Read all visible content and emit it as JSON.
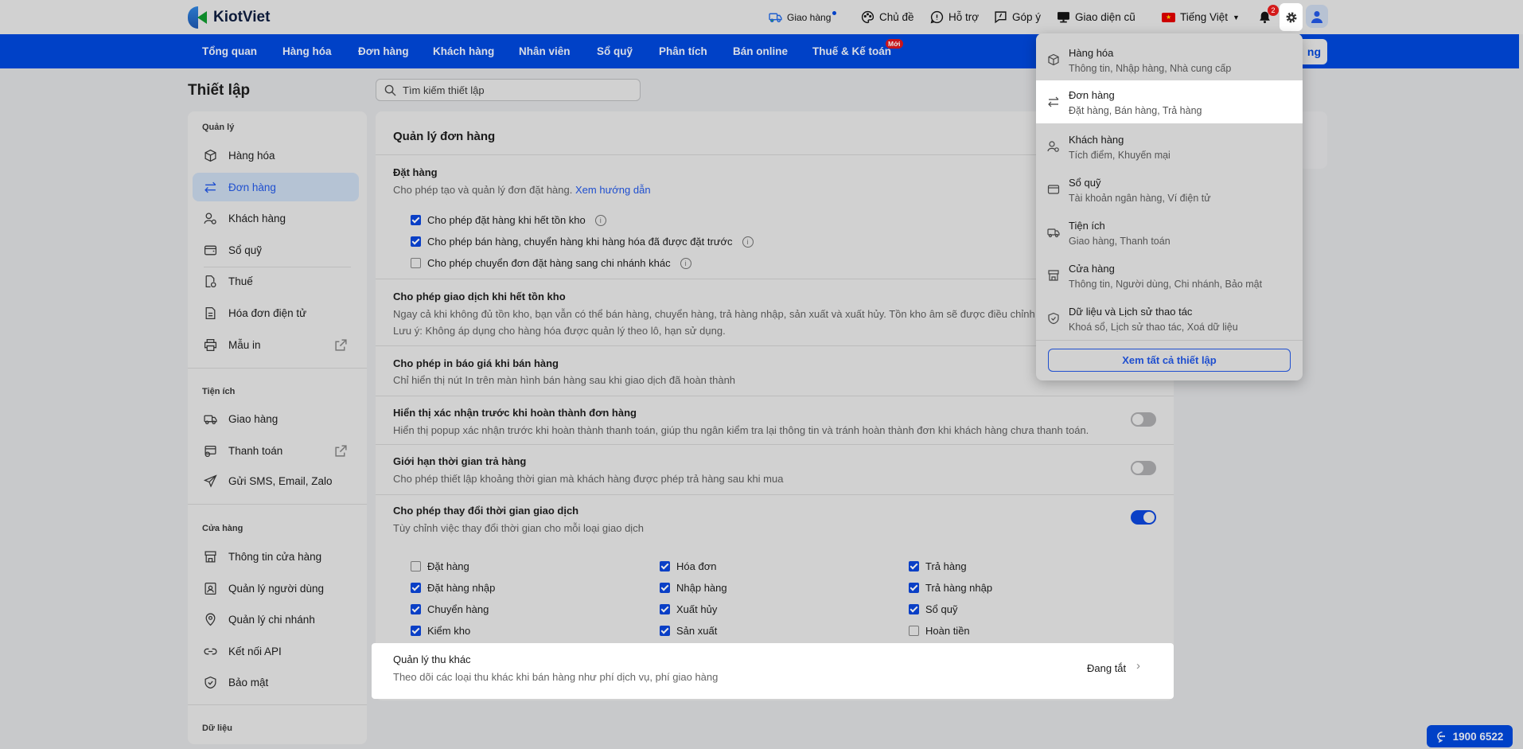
{
  "header": {
    "logo": "KiotViet",
    "items": [
      {
        "label": "Giao hàng",
        "icon": "delivery-icon"
      },
      {
        "label": "Chủ đề",
        "icon": "palette-icon"
      },
      {
        "label": "Hỗ trợ",
        "icon": "support-icon"
      },
      {
        "label": "Góp ý",
        "icon": "feedback-icon"
      },
      {
        "label": "Giao diện cũ",
        "icon": "monitor-icon"
      }
    ],
    "language": "Tiếng Việt",
    "notifications": "2"
  },
  "nav": {
    "items": [
      "Tổng quan",
      "Hàng hóa",
      "Đơn hàng",
      "Khách hàng",
      "Nhân viên",
      "Sổ quỹ",
      "Phân tích",
      "Bán online",
      "Thuế & Kế toán"
    ],
    "new_badge": "Mới",
    "button_partial": "ng"
  },
  "page": {
    "title": "Thiết lập",
    "search_placeholder": "Tìm kiếm thiết lập"
  },
  "sidebar": {
    "sections": [
      {
        "label": "Quản lý",
        "items": [
          "Hàng hóa",
          "Đơn hàng",
          "Khách hàng",
          "Sổ quỹ",
          "Thuế",
          "Hóa đơn điện tử",
          "Mẫu in"
        ]
      },
      {
        "label": "Tiện ích",
        "items": [
          "Giao hàng",
          "Thanh toán",
          "Gửi SMS, Email, Zalo"
        ]
      },
      {
        "label": "Cửa hàng",
        "items": [
          "Thông tin cửa hàng",
          "Quản lý người dùng",
          "Quản lý chi nhánh",
          "Kết nối API",
          "Bảo mật"
        ]
      },
      {
        "label": "Dữ liệu"
      }
    ]
  },
  "main": {
    "title": "Quản lý đơn hàng",
    "dat_hang": {
      "title": "Đặt hàng",
      "desc": "Cho phép tạo và quản lý đơn đặt hàng.",
      "link": "Xem hướng dẫn",
      "options": [
        {
          "label": "Cho phép đặt hàng khi hết tồn kho",
          "checked": true
        },
        {
          "label": "Cho phép bán hàng, chuyển hàng khi hàng hóa đã được đặt trước",
          "checked": true
        },
        {
          "label": "Cho phép chuyển đơn đặt hàng sang chi nhánh khác",
          "checked": false
        }
      ]
    },
    "giao_dich": {
      "title": "Cho phép giao dịch khi hết tồn kho",
      "desc": "Ngay cả khi không đủ tồn kho, bạn vẫn có thể bán hàng, chuyển hàng, trả hàng nhập, sản xuất và xuất hủy. Tồn kho âm sẽ được điều chỉnh",
      "note": "Lưu ý: Không áp dụng cho hàng hóa được quản lý theo lô, hạn sử dụng."
    },
    "in_bao_gia": {
      "title": "Cho phép in báo giá khi bán hàng",
      "desc": "Chỉ hiển thị nút In trên màn hình bán hàng sau khi giao dịch đã hoàn thành"
    },
    "xac_nhan": {
      "title": "Hiển thị xác nhận trước khi hoàn thành đơn hàng",
      "desc": "Hiển thị popup xác nhận trước khi hoàn thành thanh toán, giúp thu ngân kiểm tra lại thông tin và tránh hoàn thành đơn khi khách hàng chưa thanh toán.",
      "enabled": false
    },
    "gioi_han": {
      "title": "Giới hạn thời gian trả hàng",
      "desc": "Cho phép thiết lập khoảng thời gian mà khách hàng được phép trả hàng sau khi mua",
      "enabled": false
    },
    "thay_doi": {
      "title": "Cho phép thay đổi thời gian giao dịch",
      "desc": "Tùy chỉnh việc thay đổi thời gian cho mỗi loại giao dịch",
      "enabled": true,
      "options": [
        {
          "label": "Đặt hàng",
          "checked": false
        },
        {
          "label": "Hóa đơn",
          "checked": true
        },
        {
          "label": "Trả hàng",
          "checked": true
        },
        {
          "label": "Đặt hàng nhập",
          "checked": true
        },
        {
          "label": "Nhập hàng",
          "checked": true
        },
        {
          "label": "Trả hàng nhập",
          "checked": true
        },
        {
          "label": "Chuyển hàng",
          "checked": true
        },
        {
          "label": "Xuất hủy",
          "checked": true
        },
        {
          "label": "Sổ quỹ",
          "checked": true
        },
        {
          "label": "Kiểm kho",
          "checked": true
        },
        {
          "label": "Sản xuất",
          "checked": true
        },
        {
          "label": "Hoàn tiền",
          "checked": false
        }
      ]
    },
    "thu_khac": {
      "title": "Quản lý thu khác",
      "desc": "Theo dõi các loại thu khác khi bán hàng như phí dịch vụ, phí giao hàng",
      "status": "Đang tắt"
    }
  },
  "dropdown": {
    "items": [
      {
        "title": "Hàng hóa",
        "sub": "Thông tin, Nhập hàng, Nhà cung cấp",
        "icon": "box-icon"
      },
      {
        "title": "Đơn hàng",
        "sub": "Đặt hàng, Bán hàng, Trả hàng",
        "icon": "swap-icon"
      },
      {
        "title": "Khách hàng",
        "sub": "Tích điểm, Khuyến mại",
        "icon": "customer-icon"
      },
      {
        "title": "Sổ quỹ",
        "sub": "Tài khoản ngân hàng, Ví điện tử",
        "icon": "wallet-icon"
      },
      {
        "title": "Tiện ích",
        "sub": "Giao hàng, Thanh toán",
        "icon": "truck-icon"
      },
      {
        "title": "Cửa hàng",
        "sub": "Thông tin, Người dùng, Chi nhánh, Bảo mật",
        "icon": "store-icon"
      },
      {
        "title": "Dữ liệu và Lịch sử thao tác",
        "sub": "Khoá sổ, Lịch sử thao tác, Xoá dữ liệu",
        "icon": "shield-icon"
      }
    ],
    "view_all": "Xem tất cả thiết lập"
  },
  "hotline": "1900 6522",
  "colors": {
    "brand": "#0041c7",
    "link": "#1f4fcf"
  }
}
